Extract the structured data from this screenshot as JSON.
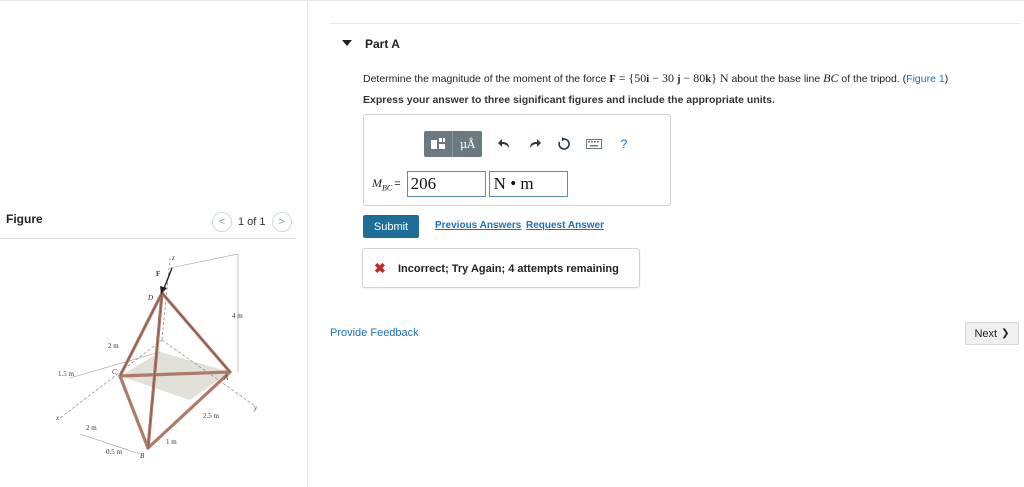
{
  "figure_panel": {
    "title": "Figure",
    "pager_text": "1 of 1",
    "prev_glyph": "<",
    "next_glyph": ">",
    "diagram_labels": {
      "z": "z",
      "F": "F",
      "D": "D",
      "dim_4m": "4 m",
      "dim_2m_top": "2 m",
      "dim_1_5m": "1.5 m",
      "C": "C",
      "A": "A",
      "x": "x",
      "y": "y",
      "dim_2m_bottom": "2 m",
      "dim_2_5m": "2.5 m",
      "dim_1m": "1 m",
      "dim_0_5m": "0.5 m",
      "B": "B"
    }
  },
  "part": {
    "caret_icon": "triangle-down",
    "title": "Part A"
  },
  "question": {
    "prefix": "Determine the magnitude of the moment of the force ",
    "force_symbol": "F",
    "force_expr": " = {50",
    "i": "i",
    "mid1": " − 30 ",
    "j": "j",
    "mid2": " − 80",
    "k": "k",
    "close": "} ",
    "unit_N": "N",
    "middle": " about the base line ",
    "line": "BC",
    "suffix": " of the tripod. (",
    "figure_link": "Figure 1",
    "suffix_end": ")",
    "instruction": "Express your answer to three significant figures and include the appropriate units."
  },
  "toolbar": {
    "template_icon": "template-icon",
    "units_label": "μÅ",
    "undo_icon": "undo-icon",
    "redo_icon": "redo-icon",
    "reset_icon": "reset-icon",
    "keyboard_icon": "keyboard-icon",
    "help_label": "?"
  },
  "answer": {
    "label_M": "M",
    "label_sub": "BC",
    "label_eq": "=",
    "value": "206",
    "units": "N • m"
  },
  "actions": {
    "submit": "Submit",
    "previous_answers": "Previous Answers",
    "request_answer": "Request Answer"
  },
  "feedback": {
    "icon": "x-icon",
    "icon_glyph": "✖",
    "message": "Incorrect; Try Again; 4 attempts remaining",
    "color": "#c62828"
  },
  "footer": {
    "provide_feedback": "Provide Feedback",
    "next": "Next",
    "next_glyph": "❯"
  },
  "colors": {
    "accent_link": "#1a72b8",
    "submit_bg": "#1e6f97",
    "toolbar_bg": "#6b7980"
  }
}
